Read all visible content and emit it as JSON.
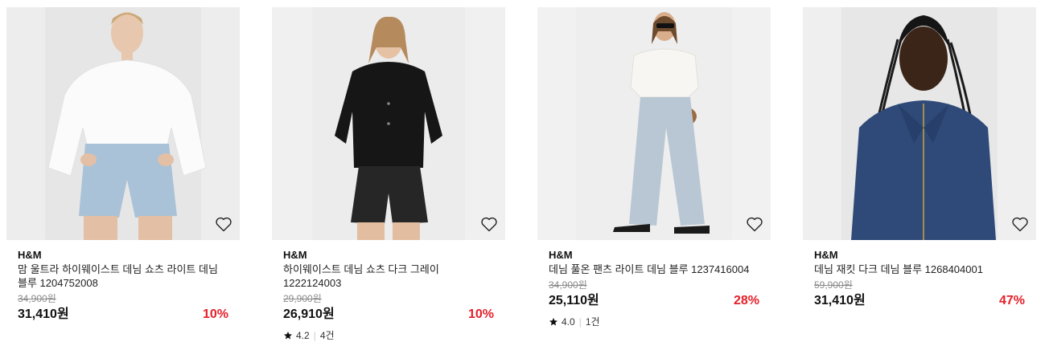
{
  "products": [
    {
      "brand": "H&M",
      "name": "맘 울트라 하이웨이스트 데님 쇼츠 라이트 데님 블루 1204752008",
      "original_price": "34,900원",
      "price": "31,410원",
      "discount": "10%",
      "rating": "",
      "review_count": ""
    },
    {
      "brand": "H&M",
      "name": "하이웨이스트 데님 쇼츠 다크 그레이 1222124003",
      "original_price": "29,900원",
      "price": "26,910원",
      "discount": "10%",
      "rating": "4.2",
      "review_count": "4건"
    },
    {
      "brand": "H&M",
      "name": "데님 풀온 팬츠 라이트 데님 블루 1237416004",
      "original_price": "34,900원",
      "price": "25,110원",
      "discount": "28%",
      "rating": "4.0",
      "review_count": "1건"
    },
    {
      "brand": "H&M",
      "name": "데님 재킷 다크 데님 블루 1268404001",
      "original_price": "59,900원",
      "price": "31,410원",
      "discount": "47%",
      "rating": "",
      "review_count": ""
    }
  ],
  "colors": {
    "discount": "#e4202a",
    "strike": "#8a8a8a"
  },
  "icons": {
    "wishlist": "heart-outline-icon",
    "rating": "star-icon"
  }
}
